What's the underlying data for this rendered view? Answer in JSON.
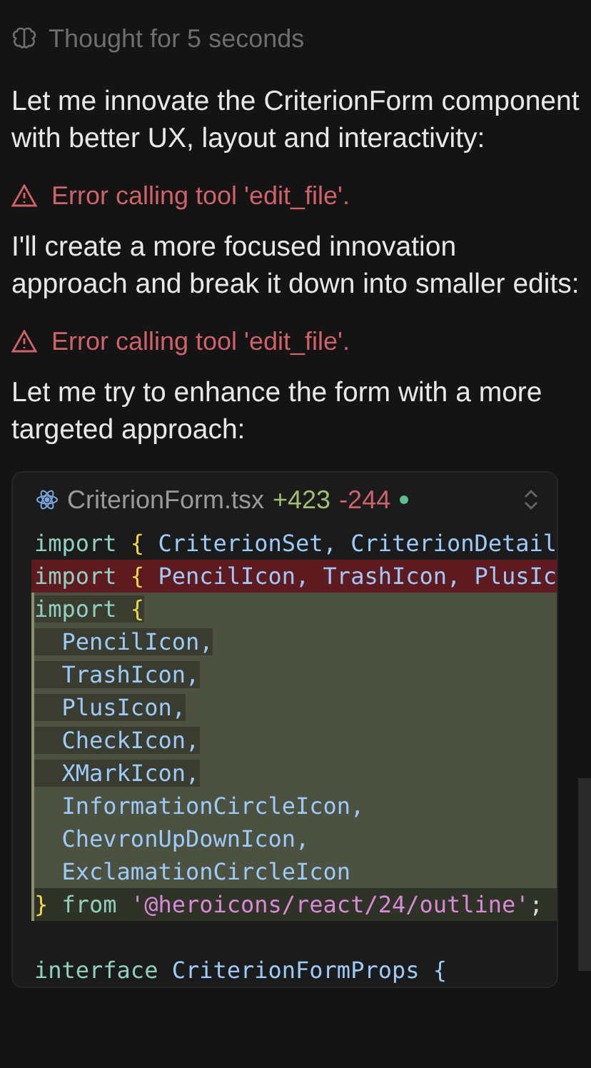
{
  "thought": {
    "label": "Thought for 5 seconds"
  },
  "messages": [
    {
      "kind": "text",
      "text": "Let me innovate the CriterionForm component with better UX, layout and interactivity:"
    },
    {
      "kind": "error",
      "text": "Error calling tool 'edit_file'."
    },
    {
      "kind": "text",
      "text": "I'll create a more focused innovation approach and break it down into smaller edits:"
    },
    {
      "kind": "error",
      "text": "Error calling tool 'edit_file'."
    },
    {
      "kind": "text",
      "text": "Let me try to enhance the form with a more targeted approach:"
    }
  ],
  "code_panel": {
    "filename": "CriterionForm.tsx",
    "added": "+423",
    "removed": "-244",
    "lines": [
      {
        "kind": "context",
        "segments": [
          {
            "kind": "keyword",
            "text": "import"
          },
          {
            "kind": "brace",
            "text": " { "
          },
          {
            "kind": "ident",
            "text": "CriterionSet, CriterionDetail"
          }
        ]
      },
      {
        "kind": "removed",
        "segments": [
          {
            "kind": "keyword",
            "text": "import"
          },
          {
            "kind": "brace",
            "text": " { "
          },
          {
            "kind": "ident",
            "text": "PencilIcon, TrashIcon, PlusIc"
          }
        ]
      },
      {
        "kind": "added",
        "segments": [
          {
            "kind": "keyword",
            "text": "import",
            "changed": true
          },
          {
            "kind": "brace",
            "text": " {",
            "changed": true
          }
        ]
      },
      {
        "kind": "added",
        "segments": [
          {
            "kind": "ident",
            "text": "  PencilIcon,",
            "changed": true
          }
        ]
      },
      {
        "kind": "added",
        "segments": [
          {
            "kind": "ident",
            "text": "  TrashIcon,",
            "changed": true
          }
        ]
      },
      {
        "kind": "added",
        "segments": [
          {
            "kind": "ident",
            "text": "  PlusIcon,",
            "changed": true
          }
        ]
      },
      {
        "kind": "added",
        "segments": [
          {
            "kind": "ident",
            "text": "  CheckIcon,",
            "changed": true
          }
        ]
      },
      {
        "kind": "added",
        "segments": [
          {
            "kind": "ident",
            "text": "  XMarkIcon,",
            "changed": true
          }
        ]
      },
      {
        "kind": "added",
        "segments": [
          {
            "kind": "ident",
            "text": "  InformationCircleIcon,"
          }
        ]
      },
      {
        "kind": "added",
        "segments": [
          {
            "kind": "ident",
            "text": "  ChevronUpDownIcon,"
          }
        ]
      },
      {
        "kind": "added",
        "segments": [
          {
            "kind": "ident",
            "text": "  ExclamationCircleIcon"
          }
        ]
      },
      {
        "kind": "added-dim",
        "segments": [
          {
            "kind": "brace",
            "text": "}"
          },
          {
            "kind": "keyword",
            "text": " from "
          },
          {
            "kind": "string",
            "text": "'@heroicons/react/24/outline'"
          },
          {
            "kind": "punct",
            "text": ";"
          }
        ]
      },
      {
        "kind": "blank"
      },
      {
        "kind": "context",
        "segments": [
          {
            "kind": "keyword",
            "text": "interface"
          },
          {
            "kind": "ident",
            "text": " CriterionFormProps {"
          }
        ]
      }
    ]
  }
}
